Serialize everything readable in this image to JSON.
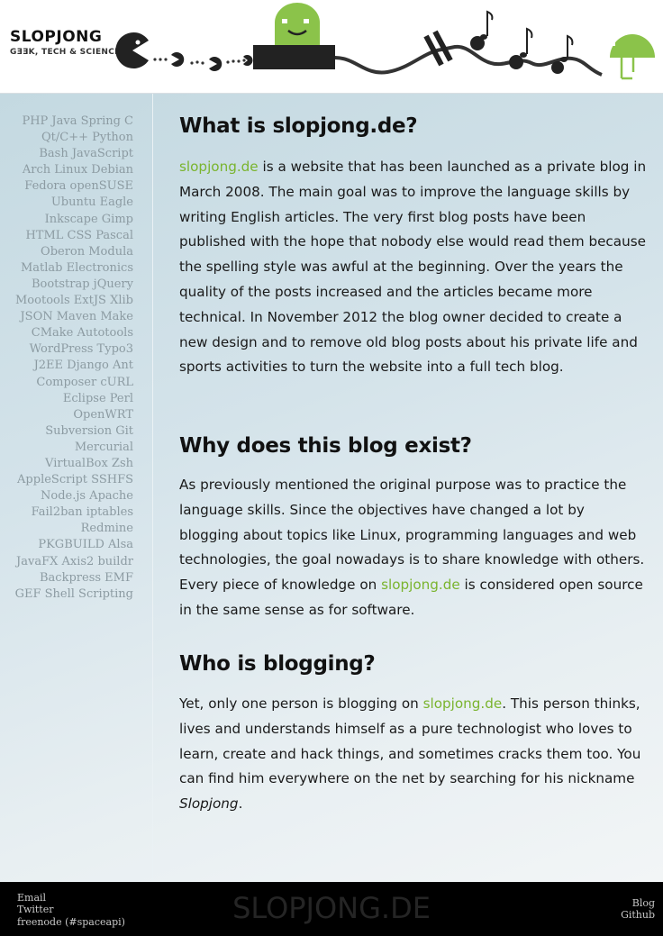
{
  "header": {
    "logo_title": "SLOPJONG",
    "logo_subtitle": "GƎƎK, TECH & SCIENCE",
    "colors": {
      "accent": "#8bc34a",
      "ink": "#222222"
    }
  },
  "sidebar": {
    "tags": [
      "PHP Java Spring C",
      "Qt/C++ Python",
      "Bash JavaScript",
      "Arch Linux Debian",
      "Fedora openSUSE",
      "Ubuntu Eagle",
      "Inkscape Gimp",
      "HTML CSS Pascal",
      "Oberon Modula",
      "Matlab Electronics",
      "Bootstrap jQuery",
      "Mootools ExtJS Xlib",
      "JSON Maven Make",
      "CMake Autotools",
      "WordPress Typo3",
      "J2EE Django Ant",
      "Composer cURL",
      "Eclipse Perl",
      "OpenWRT",
      "Subversion Git",
      "Mercurial",
      "VirtualBox Zsh",
      "AppleScript SSHFS",
      "Node.js Apache",
      "Fail2ban iptables",
      "Redmine",
      "PKGBUILD Alsa",
      "JavaFX Axis2 buildr",
      "Backpress EMF",
      "GEF Shell Scripting"
    ]
  },
  "content": {
    "section1": {
      "heading": "What is slopjong.de?",
      "link": "slopjong.de",
      "text": " is a website that has been launched as a private blog in March 2008. The main goal was to improve the language skills by writing English articles. The very first blog posts have been published with the hope that nobody else would read them because the spelling style was awful at the beginning. Over the years the quality of the posts increased and the articles became more technical. In November 2012 the blog owner decided to create a new design and to remove old blog posts about his private life and sports activities to turn the website into a full tech blog."
    },
    "section2": {
      "heading": "Why does this blog exist?",
      "text_before": "As previously mentioned the original purpose was to practice the language skills. Since the objectives have changed a lot by blogging about topics like Linux, programming languages and web technologies, the goal nowadays is to share knowledge with others. Every piece of knowledge on ",
      "link": "slopjong.de",
      "text_after": " is considered open source in the same sense as for software."
    },
    "section3": {
      "heading": "Who is blogging?",
      "text_before": "Yet, only one person is blogging on ",
      "link": "slopjong.de",
      "text_middle": ". This person thinks, lives and understands himself as a pure technologist who loves to learn, create and hack things, and sometimes cracks them too. You can find him everywhere on the net by searching for his nickname ",
      "nickname": "Slopjong",
      "text_end": "."
    },
    "link_color": "#7ab42e"
  },
  "footer": {
    "left_links": [
      "Email",
      "Twitter",
      "freenode (#spaceapi)"
    ],
    "brand": "SLOPJONG.DE",
    "right_links": [
      "Blog",
      "Github"
    ]
  }
}
